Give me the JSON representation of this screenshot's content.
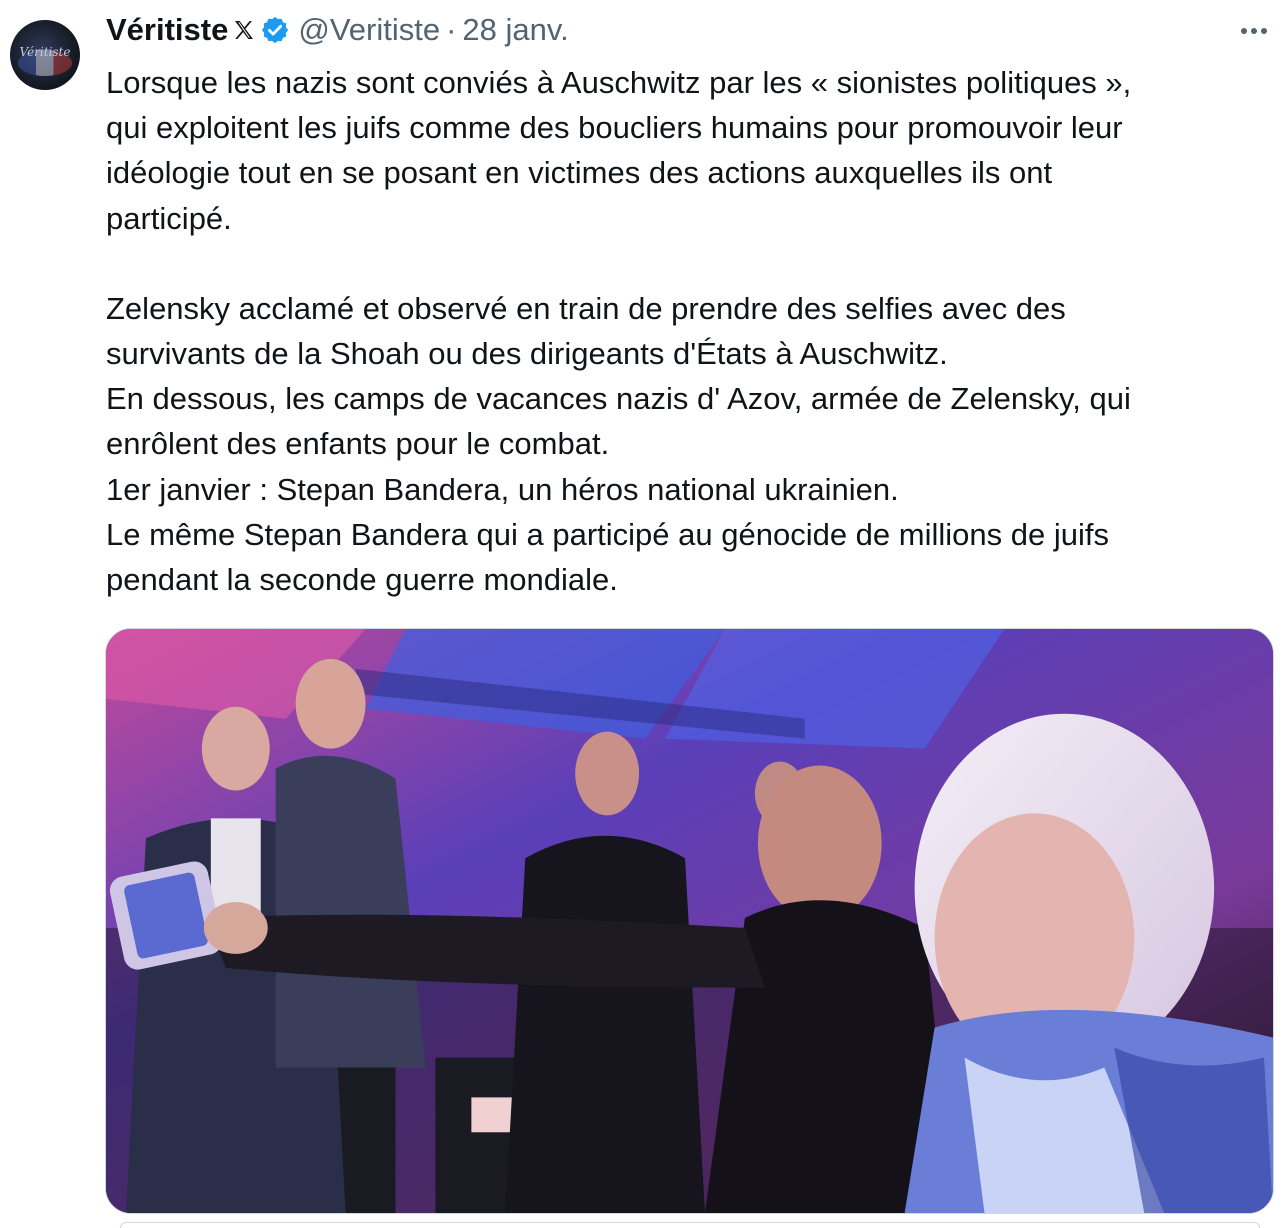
{
  "author": {
    "display_name": "Véritiste",
    "handle": "@Veritiste",
    "avatar_text": "Véritiste"
  },
  "meta": {
    "separator": "·",
    "date": "28 janv."
  },
  "icons": {
    "x_badge": "x-logo-icon",
    "verified": "verified-badge-icon",
    "more": "more-options-icon"
  },
  "colors": {
    "verified_blue": "#1d9bf0",
    "secondary_text": "#536471",
    "border": "#cfd9de"
  },
  "tweet_lines": {
    "p1": [
      "Lorsque les nazis sont conviés à Auschwitz par les « sionistes politiques »,",
      "qui exploitent les juifs comme des boucliers humains pour promouvoir leur",
      "idéologie tout en se posant en victimes des actions auxquelles ils ont",
      "participé."
    ],
    "p2": [
      "Zelensky acclamé et observé en train de prendre des selfies avec des",
      "survivants de la Shoah ou des dirigeants d'États à Auschwitz.",
      "En dessous, les camps de vacances nazis d' Azov, armée de Zelensky, qui",
      "enrôlent des enfants pour le combat.",
      "1er janvier : Stepan Bandera, un héros national ukrainien.",
      "Le même Stepan Bandera qui a participé au génocide de millions de juifs",
      "pendant la seconde guerre mondiale."
    ]
  }
}
